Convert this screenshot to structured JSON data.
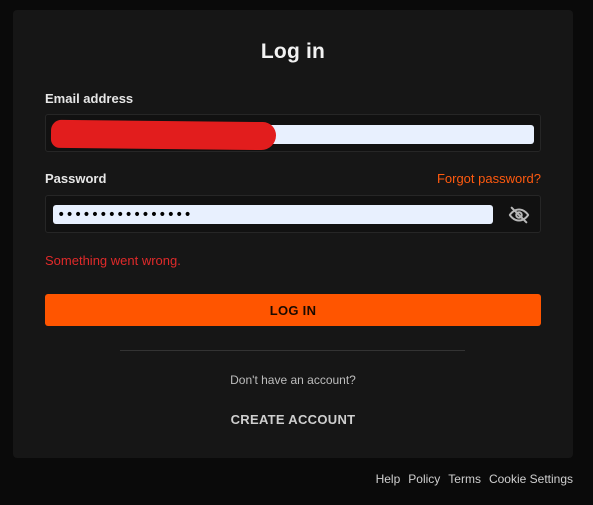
{
  "login_card": {
    "title": "Log in",
    "email": {
      "label": "Email address",
      "value": "",
      "redacted": true
    },
    "password": {
      "label": "Password",
      "forgot_label": "Forgot password?",
      "value": "••••••••••••••••",
      "visibility_icon": "eye-slash-icon"
    },
    "error_message": "Something went wrong.",
    "login_button_label": "LOG IN",
    "no_account_text": "Don't have an account?",
    "create_account_label": "CREATE ACCOUNT"
  },
  "footer": {
    "links": [
      "Help",
      "Policy",
      "Terms",
      "Cookie Settings"
    ]
  },
  "colors": {
    "accent": "#ff5500",
    "forgot_link": "#ff5a0f",
    "error": "#e02a2a",
    "redaction": "#e21d1d",
    "card_background": "#161616",
    "page_background": "#0a0a0a",
    "autofill_background": "#e8f0fe"
  }
}
